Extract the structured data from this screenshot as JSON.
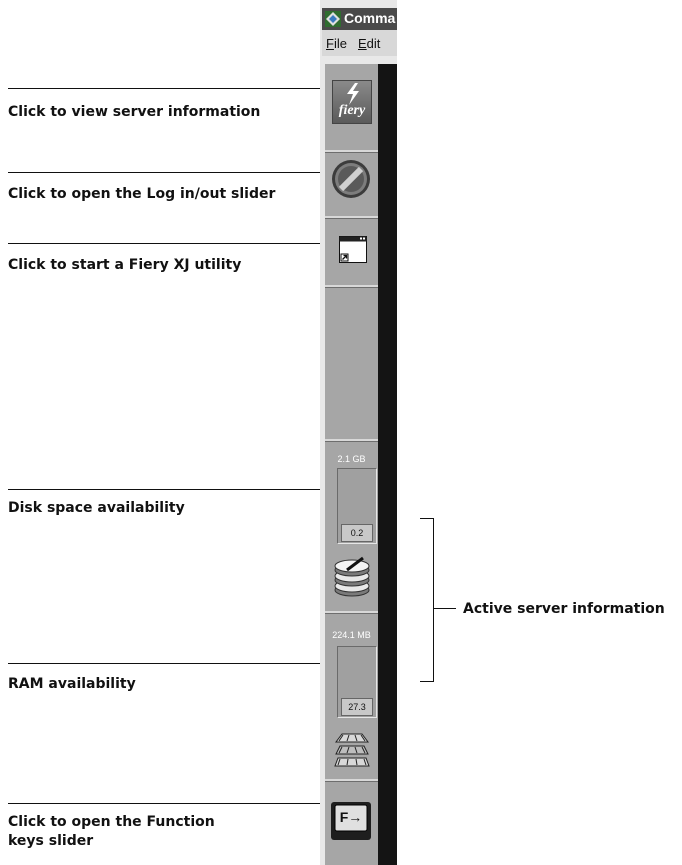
{
  "window": {
    "title": "Comma"
  },
  "menu": [
    {
      "hotkey": "F",
      "rest": "ile"
    },
    {
      "hotkey": "E",
      "rest": "dit"
    }
  ],
  "toolbar": {
    "fiery_logo_text": "fiery",
    "function_key_label": "F→"
  },
  "disk": {
    "total": "2.1 GB",
    "available": "0.2"
  },
  "ram": {
    "total": "224.1 MB",
    "available": "27.3"
  },
  "callouts": {
    "server_info": "Click to view server information",
    "login_slider": "Click to open the Log in/out slider",
    "utility": "Click to start a Fiery XJ utility",
    "disk_space": "Disk space availability",
    "ram": "RAM availability",
    "active_server": "Active server information",
    "function_keys_line1": "Click to open the Function",
    "function_keys_line2": "keys slider"
  },
  "icons": {
    "title": "app-window-icon",
    "server_info": "fiery-logo-icon",
    "login": "knob-icon",
    "utility": "application-window-icon",
    "disk": "disk-stack-icon",
    "ram": "memory-chips-icon",
    "function_keys": "function-key-icon"
  }
}
